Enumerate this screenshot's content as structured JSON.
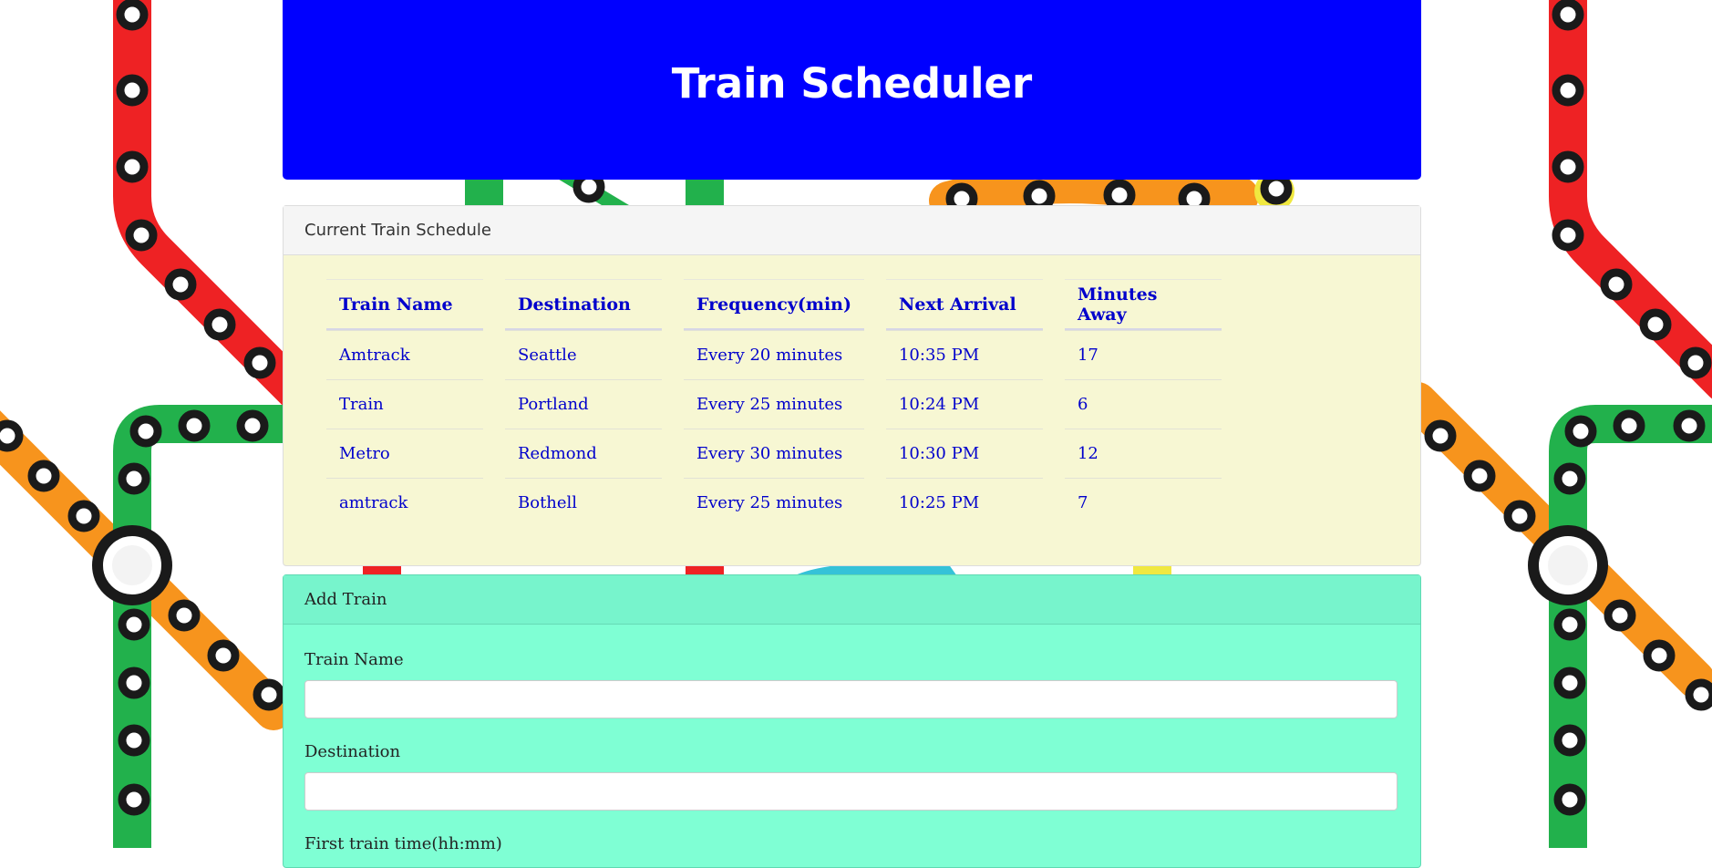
{
  "header": {
    "title": "Train Scheduler"
  },
  "schedule": {
    "panel_title": "Current Train Schedule",
    "columns": [
      "Train Name",
      "Destination",
      "Frequency(min)",
      "Next Arrival",
      "Minutes Away"
    ],
    "rows": [
      [
        "Amtrack",
        "Seattle",
        "Every 20 minutes",
        "10:35 PM",
        "17"
      ],
      [
        "Train",
        "Portland",
        "Every 25 minutes",
        "10:24 PM",
        "6"
      ],
      [
        "Metro",
        "Redmond",
        "Every 30 minutes",
        "10:30 PM",
        "12"
      ],
      [
        "amtrack",
        "Bothell",
        "Every 25 minutes",
        "10:25 PM",
        "7"
      ]
    ]
  },
  "add_train": {
    "panel_title": "Add Train",
    "fields": {
      "train_name_label": "Train Name",
      "train_name_value": "",
      "destination_label": "Destination",
      "destination_value": "",
      "first_time_label": "First train time(hh:mm)"
    }
  },
  "colors": {
    "jumbotron": "#0000ff",
    "schedule_panel": "#f7f7d3",
    "add_panel": "#7fffd4",
    "line_red": "#ee2224",
    "line_green": "#22b14c",
    "line_orange": "#f7941d",
    "line_cyan": "#35c2d8",
    "line_yellow": "#f0e840"
  }
}
